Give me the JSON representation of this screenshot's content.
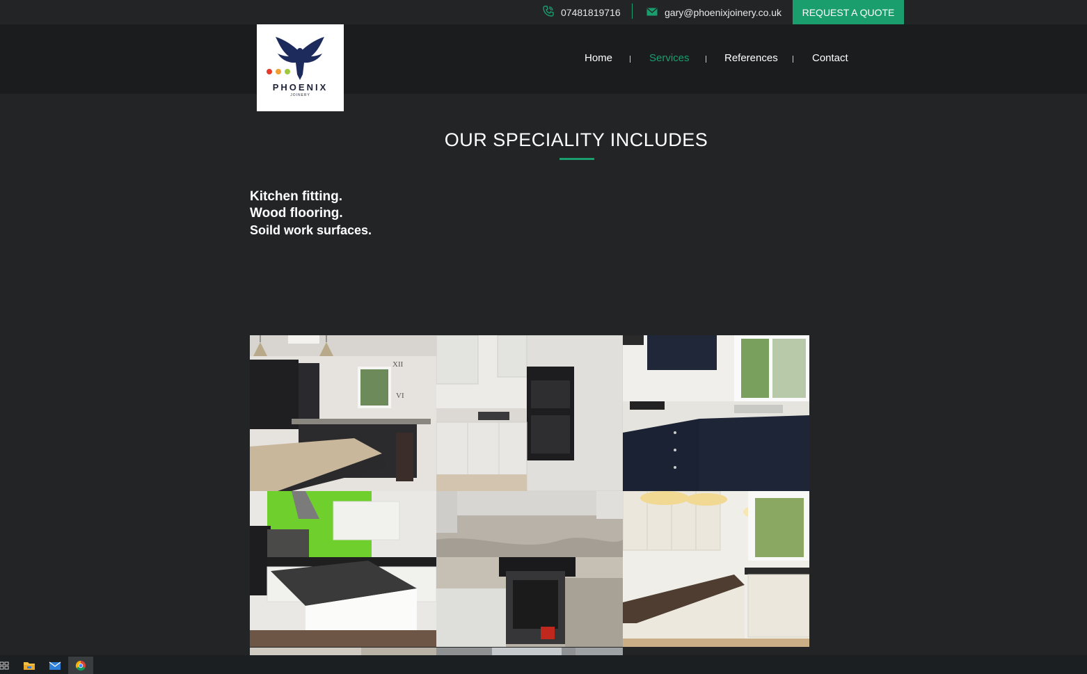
{
  "topbar": {
    "phone": "07481819716",
    "email": "gary@phoenixjoinery.co.uk",
    "quote_label": "REQUEST A QUOTE"
  },
  "logo": {
    "brand": "PHOENIX",
    "sub": "JOINERY"
  },
  "nav": {
    "items": [
      {
        "label": "Home"
      },
      {
        "label": "Services"
      },
      {
        "label": "References"
      },
      {
        "label": "Contact"
      }
    ]
  },
  "section": {
    "title": "OUR SPECIALITY INCLUDES",
    "items": [
      "Kitchen fitting.",
      "Wood flooring.",
      "Soild work surfaces."
    ]
  },
  "gallery": {
    "images": [
      "kitchen-photo-1",
      "kitchen-photo-2",
      "kitchen-photo-3",
      "kitchen-photo-4",
      "kitchen-photo-5",
      "kitchen-photo-6",
      "kitchen-photo-7",
      "kitchen-photo-8"
    ]
  },
  "taskbar": {
    "icons": [
      "task-view-icon",
      "file-explorer-icon",
      "mail-icon",
      "chrome-icon"
    ]
  },
  "colors": {
    "accent": "#1a9e6e",
    "background": "#222426",
    "navbar": "#1b1c1d"
  }
}
